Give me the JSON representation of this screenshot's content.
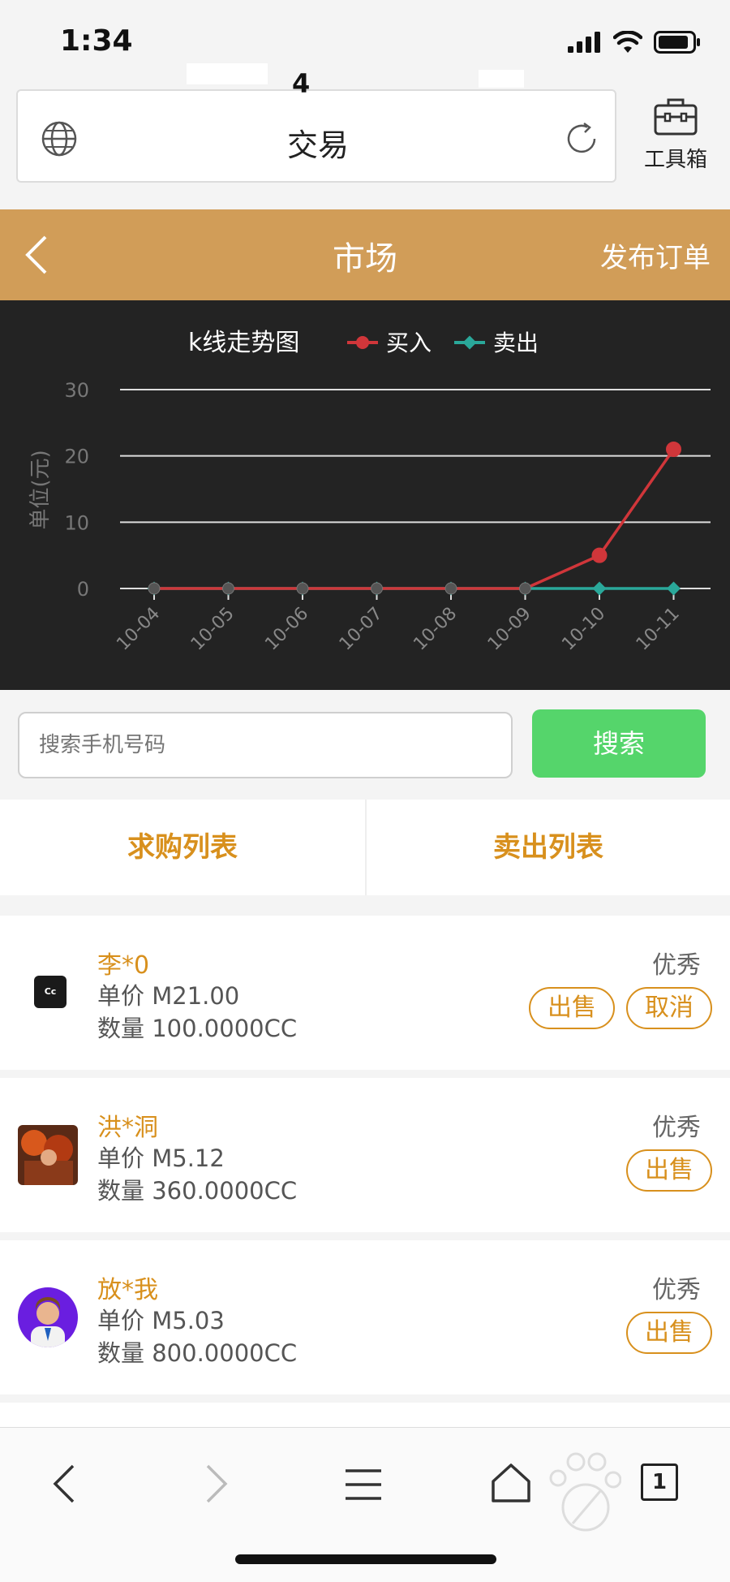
{
  "status_bar": {
    "time": "1:34"
  },
  "browser": {
    "tab_count": "4",
    "page_title": "交易",
    "toolbox_label": "工具箱",
    "open_tabs": "1"
  },
  "header": {
    "title": "市场",
    "action": "发布订单"
  },
  "chart_data": {
    "type": "line",
    "title": "k线走势图",
    "ylabel": "单位(元)",
    "ylim": [
      0,
      30
    ],
    "yticks": [
      "0",
      "10",
      "20",
      "30"
    ],
    "x": [
      "10-04",
      "10-05",
      "10-06",
      "10-07",
      "10-08",
      "10-09",
      "10-10",
      "10-11"
    ],
    "series": [
      {
        "name": "买入",
        "color": "#d0363a",
        "values": [
          0,
          0,
          0,
          0,
          0,
          0,
          5,
          21
        ]
      },
      {
        "name": "卖出",
        "color": "#2aa89a",
        "values": [
          0,
          0,
          0,
          0,
          0,
          0,
          0,
          0
        ]
      }
    ],
    "grid": true,
    "legend": "top"
  },
  "search": {
    "placeholder": "搜索手机号码",
    "button": "搜索"
  },
  "tabs": [
    "求购列表",
    "卖出列表"
  ],
  "orders": [
    {
      "name": "李*0",
      "price": "单价 M21.00",
      "qty": "数量 100.0000CC",
      "rating": "优秀",
      "actions": [
        "出售",
        "取消"
      ],
      "avatar_text": "Cc"
    },
    {
      "name": "洪*洞",
      "price": "单价 M5.12",
      "qty": "数量 360.0000CC",
      "rating": "优秀",
      "actions": [
        "出售"
      ]
    },
    {
      "name": "放*我",
      "price": "单价 M5.03",
      "qty": "数量 800.0000CC",
      "rating": "优秀",
      "actions": [
        "出售"
      ]
    }
  ],
  "colors": {
    "accent": "#d19d58",
    "orange_text": "#d8901d",
    "search_green": "#55d56b",
    "chart_bg": "#232323"
  }
}
